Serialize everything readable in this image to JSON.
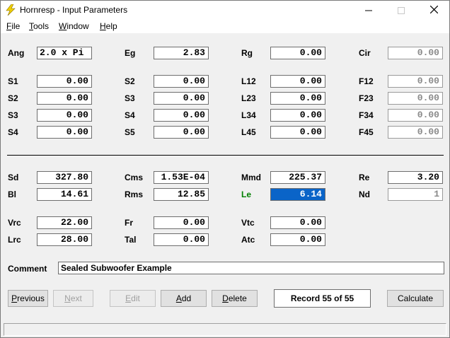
{
  "window": {
    "title": "Hornresp - Input Parameters"
  },
  "menu": [
    {
      "label": "File",
      "key": "F",
      "rest": "ile"
    },
    {
      "label": "Tools",
      "key": "T",
      "rest": "ools"
    },
    {
      "label": "Window",
      "key": "W",
      "rest": "indow"
    },
    {
      "label": "Help",
      "key": "H",
      "rest": "elp"
    }
  ],
  "params": {
    "ang": {
      "label": "Ang",
      "value": "2.0 x Pi"
    },
    "eg": {
      "label": "Eg",
      "value": "2.83"
    },
    "rg": {
      "label": "Rg",
      "value": "0.00"
    },
    "cir": {
      "label": "Cir",
      "value": "0.00"
    },
    "s1a": {
      "label": "S1",
      "value": "0.00"
    },
    "s2a": {
      "label": "S2",
      "value": "0.00"
    },
    "s3a": {
      "label": "S3",
      "value": "0.00"
    },
    "s4a": {
      "label": "S4",
      "value": "0.00"
    },
    "s2b": {
      "label": "S2",
      "value": "0.00"
    },
    "s3b": {
      "label": "S3",
      "value": "0.00"
    },
    "s4b": {
      "label": "S4",
      "value": "0.00"
    },
    "s5b": {
      "label": "S5",
      "value": "0.00"
    },
    "l12": {
      "label": "L12",
      "value": "0.00"
    },
    "l23": {
      "label": "L23",
      "value": "0.00"
    },
    "l34": {
      "label": "L34",
      "value": "0.00"
    },
    "l45": {
      "label": "L45",
      "value": "0.00"
    },
    "f12": {
      "label": "F12",
      "value": "0.00"
    },
    "f23": {
      "label": "F23",
      "value": "0.00"
    },
    "f34": {
      "label": "F34",
      "value": "0.00"
    },
    "f45": {
      "label": "F45",
      "value": "0.00"
    },
    "sd": {
      "label": "Sd",
      "value": "327.80"
    },
    "bl": {
      "label": "Bl",
      "value": "14.61"
    },
    "cms": {
      "label": "Cms",
      "value": "1.53E-04"
    },
    "rms": {
      "label": "Rms",
      "value": "12.85"
    },
    "mmd": {
      "label": "Mmd",
      "value": "225.37"
    },
    "le": {
      "label": "Le",
      "value": "6.14"
    },
    "re": {
      "label": "Re",
      "value": "3.20"
    },
    "nd": {
      "label": "Nd",
      "value": "1"
    },
    "vrc": {
      "label": "Vrc",
      "value": "22.00"
    },
    "lrc": {
      "label": "Lrc",
      "value": "28.00"
    },
    "fr": {
      "label": "Fr",
      "value": "0.00"
    },
    "tal": {
      "label": "Tal",
      "value": "0.00"
    },
    "vtc": {
      "label": "Vtc",
      "value": "0.00"
    },
    "atc": {
      "label": "Atc",
      "value": "0.00"
    }
  },
  "comment": {
    "label": "Comment",
    "value": "Sealed Subwoofer Example"
  },
  "buttons": {
    "previous": {
      "key": "P",
      "rest": "revious"
    },
    "next": {
      "key": "N",
      "rest": "ext"
    },
    "edit": {
      "key": "E",
      "rest": "dit"
    },
    "add": {
      "key": "A",
      "rest": "dd"
    },
    "delete": {
      "key": "D",
      "rest": "elete"
    },
    "calculate": "Calculate"
  },
  "record": "Record 55 of 55",
  "colors": {
    "accent": "#0a64c8",
    "le_label": "#008000",
    "icon": "#f0d000"
  }
}
